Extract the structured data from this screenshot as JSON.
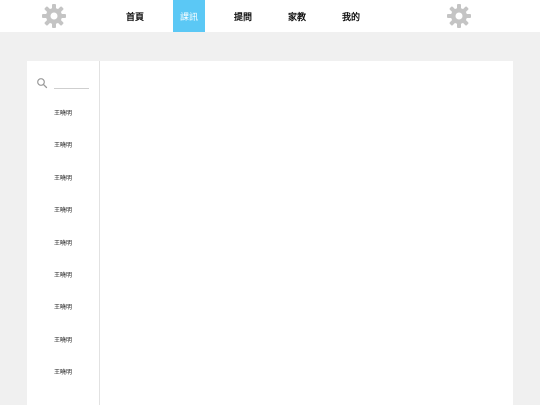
{
  "nav": {
    "items": [
      {
        "label": "首頁"
      },
      {
        "label": "課訊"
      },
      {
        "label": "提問"
      },
      {
        "label": "家教"
      },
      {
        "label": "我的"
      }
    ],
    "active_index": 1,
    "accent_color": "#5bc8f5"
  },
  "icons": {
    "left": "gear-icon",
    "right": "gear-icon",
    "search": "search-icon"
  },
  "sidebar": {
    "search_value": "",
    "contacts": [
      {
        "name": "王曉明"
      },
      {
        "name": "王曉明"
      },
      {
        "name": "王曉明"
      },
      {
        "name": "王曉明"
      },
      {
        "name": "王曉明"
      },
      {
        "name": "王曉明"
      },
      {
        "name": "王曉明"
      },
      {
        "name": "王曉明"
      },
      {
        "name": "王曉明"
      }
    ]
  }
}
